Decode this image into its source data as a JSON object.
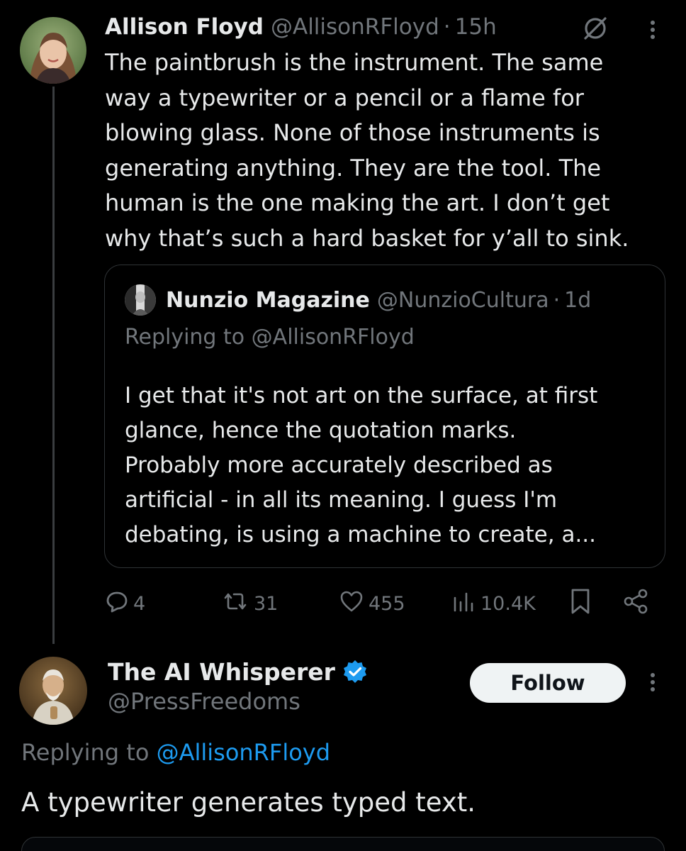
{
  "tweet": {
    "author_name": "Allison Floyd",
    "author_handle": "@AllisonRFloyd",
    "separator": "·",
    "time": "15h",
    "text": "The paintbrush is the instrument. The same\nway a typewriter or a pencil or a flame for\nblowing glass. None of those instruments is\ngenerating anything. They are the tool. The\nhuman is the one making the art. I don’t get\nwhy that’s such a hard basket for y’all to sink.",
    "quote": {
      "author_name": "Nunzio Magazine",
      "author_handle": "@NunzioCultura",
      "separator": "·",
      "time": "1d",
      "replying_to": "Replying to @AllisonRFloyd",
      "text": "I get that it's not art on the surface, at first\nglance, hence the quotation marks.\nProbably more accurately described as\nartificial - in all its meaning. I guess I'm\ndebating, is using a machine to create, a..."
    },
    "stats": {
      "replies": "4",
      "reposts": "31",
      "likes": "455",
      "views": "10.4K"
    }
  },
  "reply": {
    "author_name": "The AI Whisperer",
    "author_handle": "@PressFreedoms",
    "follow_label": "Follow",
    "replying_prefix": "Replying to ",
    "replying_handle": "@AllisonRFloyd",
    "text": "A typewriter generates typed text."
  },
  "colors": {
    "background": "#000000",
    "text_primary": "#e7e9ea",
    "text_secondary": "#71767b",
    "accent_blue": "#1d9bf0",
    "border": "#2f3336",
    "follow_bg": "#eff3f4"
  },
  "icons": [
    "grok-icon",
    "more-icon",
    "reply-icon",
    "repost-icon",
    "like-icon",
    "views-icon",
    "bookmark-icon",
    "share-icon",
    "verified-badge-icon"
  ]
}
